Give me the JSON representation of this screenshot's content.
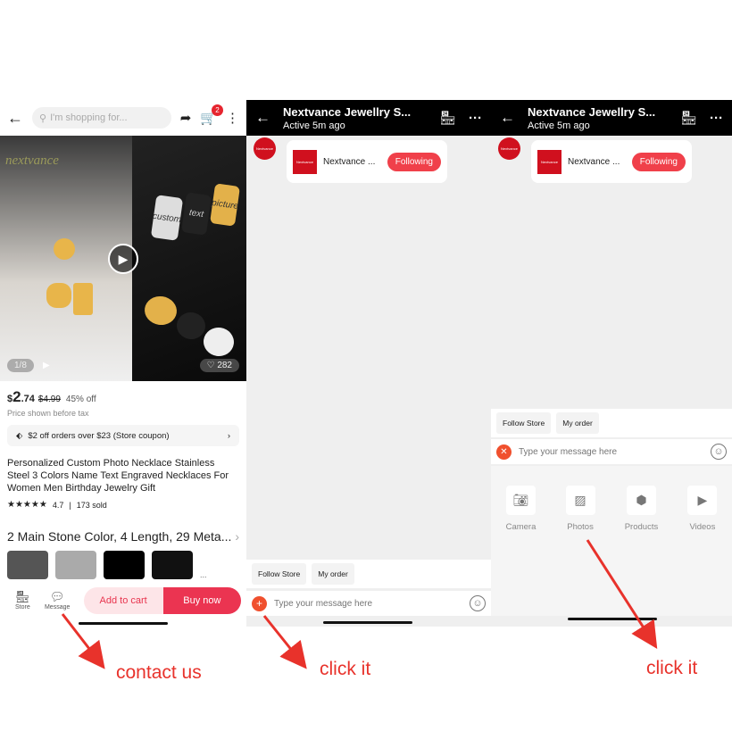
{
  "product_page": {
    "search_placeholder": "I'm shopping for...",
    "cart_count": "2",
    "image_counter": "1/8",
    "likes": "282",
    "watermark": "nextvance",
    "tag_words": [
      "custom",
      "text",
      "picture"
    ],
    "price_symbol": "$",
    "price_main": "2",
    "price_cents": ".74",
    "price_old": "$4.99",
    "discount": "45% off",
    "price_note": "Price shown before tax",
    "coupon": "$2 off orders over $23 (Store coupon)",
    "title": "Personalized Custom Photo Necklace Stainless Steel 3 Colors Name Text Engraved Necklaces For Women Men Birthday Jewelry Gift",
    "rating": "4.7",
    "sold": "173 sold",
    "rating_stars": 4.7,
    "variants": "2 Main Stone Color, 4 Length, 29 Meta...",
    "more": "...",
    "store_label": "Store",
    "message_label": "Message",
    "add_to_cart": "Add to cart",
    "buy_now": "Buy now"
  },
  "chat": {
    "store_name": "Nextvance Jewellry S...",
    "status": "Active 5m ago",
    "avatar_text": "Nextvance",
    "card_name": "Nextvance ...",
    "following": "Following",
    "quick_replies": [
      "Follow Store",
      "My order"
    ],
    "input_placeholder": "Type your message here",
    "tools": [
      {
        "label": "Camera",
        "icon": "camera-icon"
      },
      {
        "label": "Photos",
        "icon": "photos-icon"
      },
      {
        "label": "Products",
        "icon": "box-icon"
      },
      {
        "label": "Videos",
        "icon": "play-icon"
      }
    ]
  },
  "annotations": {
    "first": "contact us",
    "second": "click it",
    "third": "click it",
    "color": "#e8322b"
  }
}
